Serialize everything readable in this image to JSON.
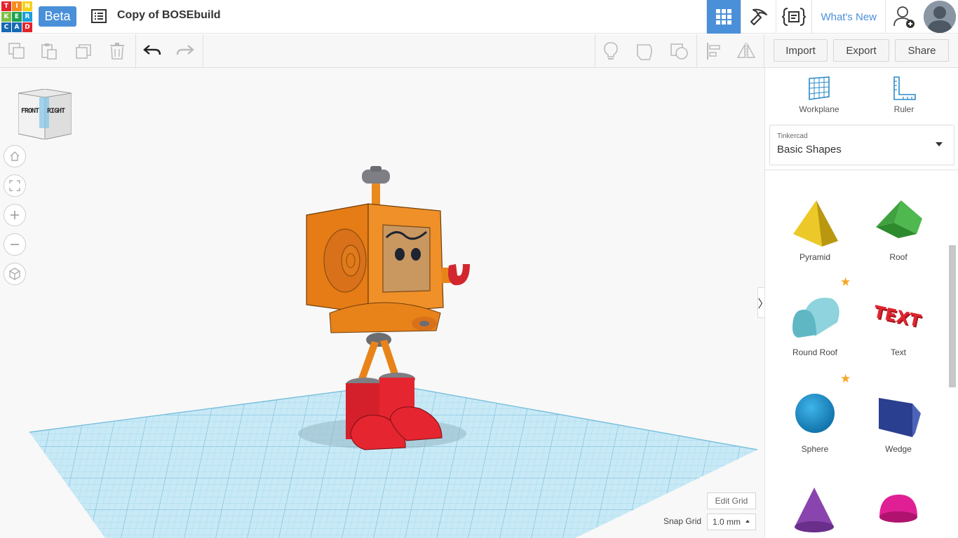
{
  "header": {
    "logo_letters": [
      "T",
      "I",
      "N",
      "K",
      "E",
      "R",
      "C",
      "A",
      "D"
    ],
    "logo_colors": [
      "#e2242b",
      "#f48d1d",
      "#f4d21d",
      "#7ac143",
      "#1aa251",
      "#1c9fd9",
      "#1769b3",
      "#1769b3",
      "#e2242b"
    ],
    "beta_label": "Beta",
    "design_title": "Copy of BOSEbuild",
    "whats_new_label": "What's New",
    "accent_color": "#4a90d9"
  },
  "toolbar": {
    "import_label": "Import",
    "export_label": "Export",
    "share_label": "Share"
  },
  "viewcube": {
    "front_label": "FRONT",
    "right_label": "RIGHT"
  },
  "viewport": {
    "edit_grid_label": "Edit Grid",
    "snap_grid_label": "Snap Grid",
    "snap_grid_value": "1.0 mm"
  },
  "panel": {
    "workplane_label": "Workplane",
    "ruler_label": "Ruler",
    "library_caption": "Tinkercad",
    "library_value": "Basic Shapes",
    "shapes": [
      {
        "name": "Pyramid",
        "color": "#e8c51f",
        "favorite": false
      },
      {
        "name": "Roof",
        "color": "#3aa53a",
        "favorite": false
      },
      {
        "name": "Round Roof",
        "color": "#6fc3cf",
        "favorite": true
      },
      {
        "name": "Text",
        "color": "#d3202a",
        "favorite": false
      },
      {
        "name": "Sphere",
        "color": "#1893d1",
        "favorite": true
      },
      {
        "name": "Wedge",
        "color": "#273a8c",
        "favorite": false
      },
      {
        "name": "Cone",
        "color": "#7b3a9c",
        "favorite": false
      },
      {
        "name": "Half Sphere",
        "color": "#d4188a",
        "favorite": false
      }
    ]
  }
}
